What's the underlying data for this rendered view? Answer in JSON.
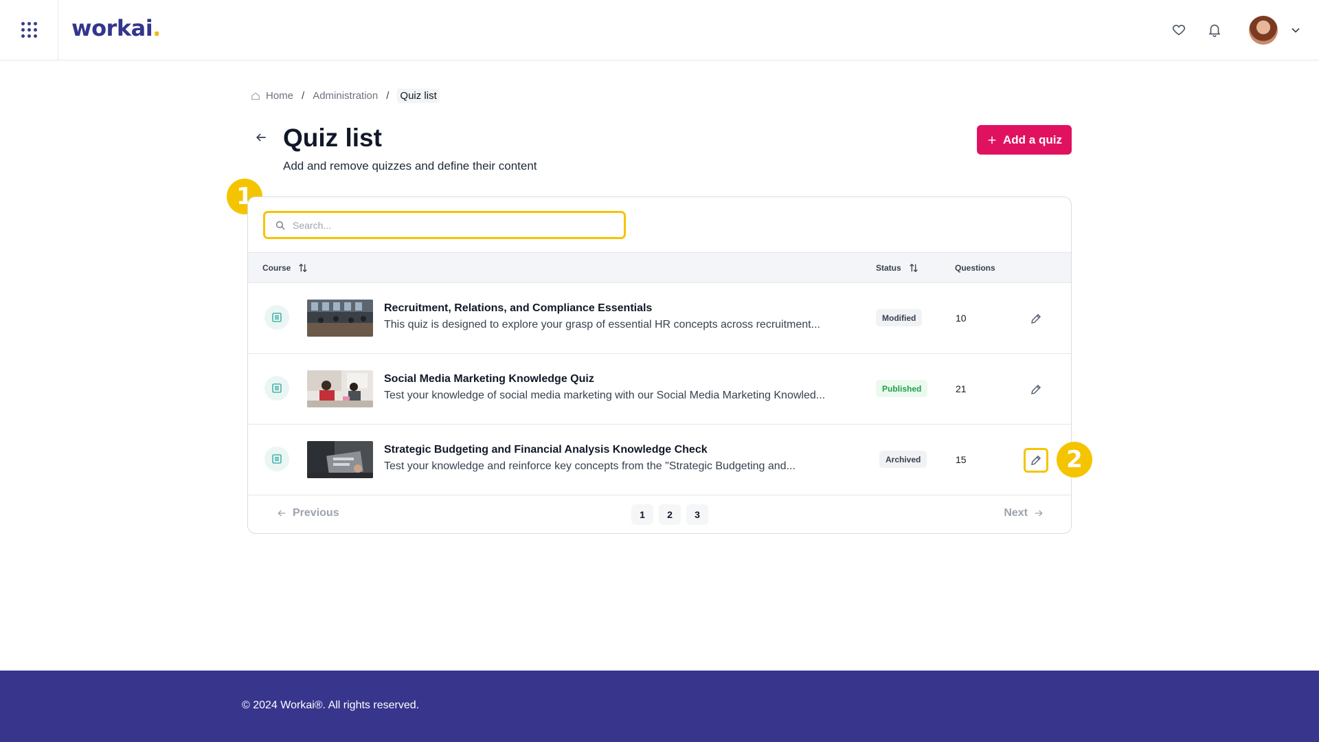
{
  "header": {
    "logo_text": "workai",
    "logo_dot": ".",
    "icons": [
      "apps-grid-icon",
      "heart-icon",
      "bell-icon",
      "avatar",
      "chevron-down-icon"
    ]
  },
  "breadcrumb": {
    "items": [
      "Home",
      "Administration",
      "Quiz list"
    ],
    "separator": "/"
  },
  "page": {
    "title": "Quiz list",
    "subtitle": "Add and remove quizzes and define their content",
    "add_button_label": "Add a quiz"
  },
  "search": {
    "placeholder": "Search...",
    "value": ""
  },
  "table": {
    "columns": {
      "course": "Course",
      "status": "Status",
      "questions": "Questions"
    },
    "rows": [
      {
        "title": "Recruitment, Relations, and Compliance Essentials",
        "description": "This quiz is designed to explore your grasp of essential HR concepts across recruitment...",
        "status": "Modified",
        "questions": "10"
      },
      {
        "title": "Social Media Marketing Knowledge Quiz",
        "description": "Test your knowledge of social media marketing with our Social Media Marketing Knowled...",
        "status": "Published",
        "questions": "21"
      },
      {
        "title": "Strategic Budgeting and Financial Analysis Knowledge Check",
        "description": "Test your knowledge and reinforce key concepts from the \"Strategic Budgeting and...",
        "status": "Archived",
        "questions": "15"
      }
    ]
  },
  "pagination": {
    "previous": "Previous",
    "next": "Next",
    "pages": [
      "1",
      "2",
      "3"
    ]
  },
  "markers": [
    "1",
    "2"
  ],
  "footer": {
    "copyright": "© 2024 Workai®. All rights reserved."
  },
  "colors": {
    "brand": "#38358c",
    "accent": "#e0125f",
    "highlight": "#f5c400",
    "published": "#1e9e4a"
  }
}
